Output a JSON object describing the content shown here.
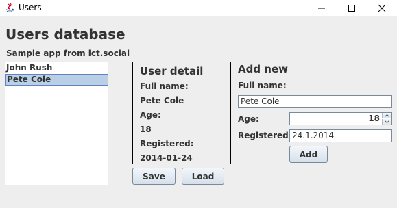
{
  "window": {
    "title": "Users",
    "controls": [
      "minimize-icon",
      "maximize-icon",
      "close-icon"
    ]
  },
  "header": {
    "title": "Users database",
    "subtitle": "Sample app from ict.social"
  },
  "users_list": {
    "items": [
      {
        "label": "John Rush",
        "selected": false
      },
      {
        "label": "Pete Cole",
        "selected": true
      }
    ]
  },
  "detail": {
    "title": "User detail",
    "full_name_label": "Full name:",
    "full_name": "Pete Cole",
    "age_label": "Age:",
    "age": "18",
    "registered_label": "Registered:",
    "registered": "2014-01-24"
  },
  "buttons": {
    "save": "Save",
    "load": "Load",
    "add": "Add"
  },
  "add_new": {
    "title": "Add new",
    "full_name_label": "Full name:",
    "full_name_value": "Pete Cole",
    "age_label": "Age:",
    "age_value": "18",
    "registered_label": "Registered:",
    "registered_value": "24.1.2014"
  },
  "colors": {
    "selection": "#b8cfe5",
    "selection_border": "#6382bf",
    "background": "#eeeeee"
  }
}
